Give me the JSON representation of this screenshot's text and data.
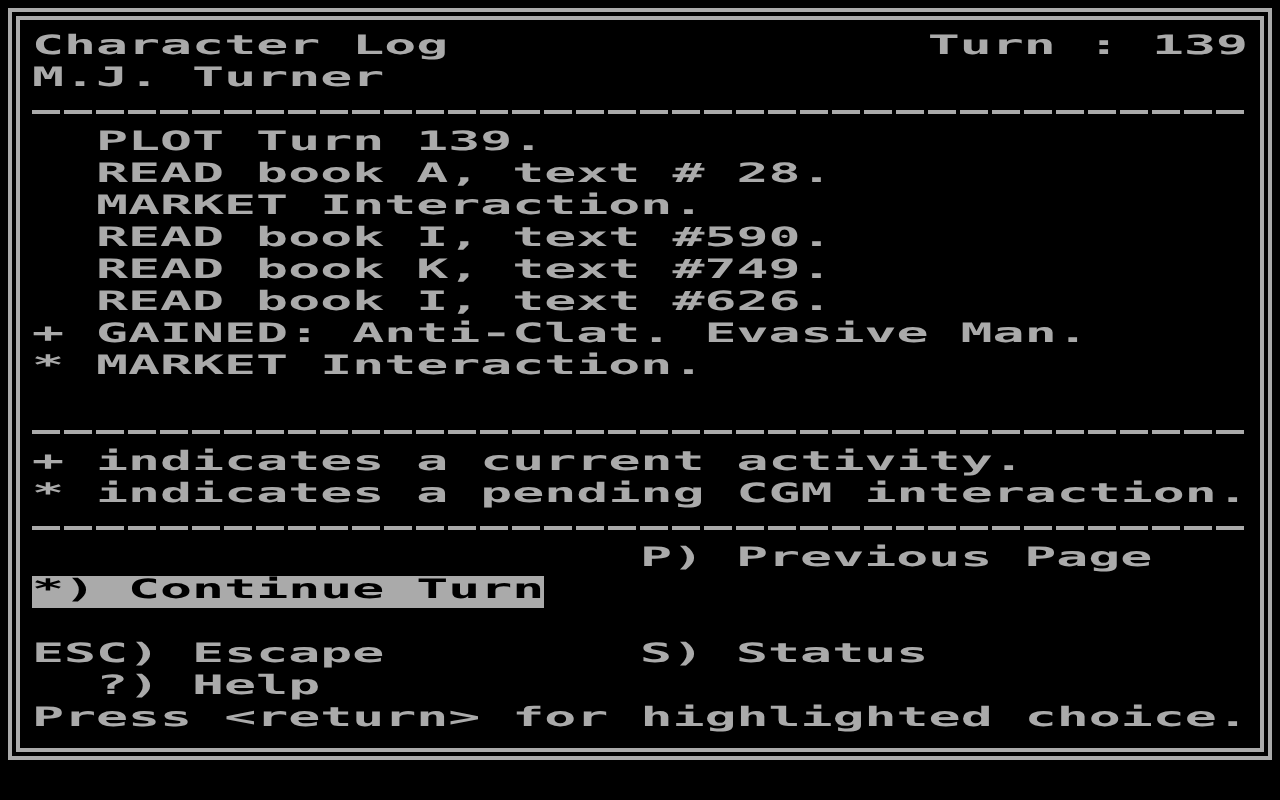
{
  "header": {
    "title": "Character Log",
    "turn": "Turn : 139",
    "character": "M.J. Turner"
  },
  "log": [
    {
      "text": "PLOT Turn 139."
    },
    {
      "text": "READ book A, text # 28."
    },
    {
      "text": "MARKET Interaction."
    },
    {
      "text": "READ book I, text #590."
    },
    {
      "text": "READ book K, text #749."
    },
    {
      "text": "READ book I, text #626."
    },
    {
      "marker": "+",
      "text": "GAINED: Anti-Clat. Evasive Man."
    },
    {
      "marker": "*",
      "text": "MARKET Interaction."
    }
  ],
  "legend": [
    "+ indicates a current activity.",
    "* indicates a pending CGM interaction."
  ],
  "menu": [
    {
      "label": "P) Previous Page",
      "selected": false
    },
    {
      "label": "*) Continue Turn",
      "selected": true
    },
    {
      "label": "ESC) Escape",
      "selected": false
    },
    {
      "label": "S) Status",
      "selected": false
    },
    {
      "label": "?) Help",
      "selected": false
    }
  ],
  "hint": "Press <return> for highlighted choice."
}
